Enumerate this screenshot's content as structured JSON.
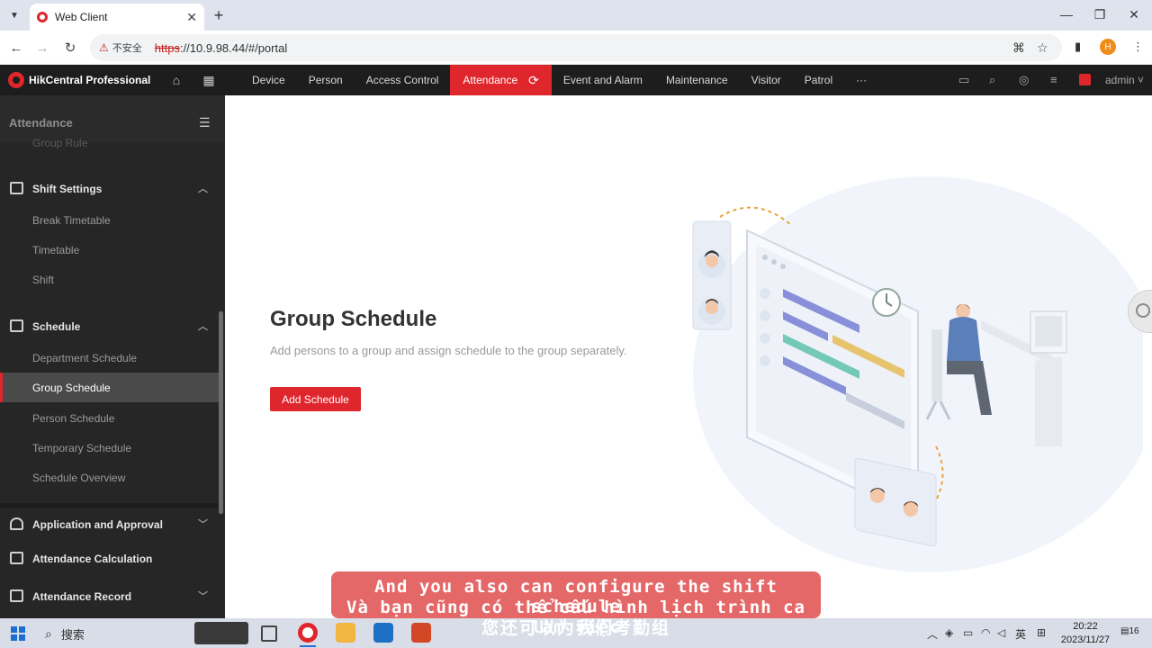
{
  "browser": {
    "tab_title": "Web Client",
    "url_scheme": "https",
    "url_rest": "://10.9.98.44/#/portal",
    "insecure_label": "不安全",
    "profile_initial": "H"
  },
  "app": {
    "name": "HikCentral Professional",
    "nav": [
      "Device",
      "Person",
      "Access Control",
      "Attendance",
      "Event and Alarm",
      "Maintenance",
      "Visitor",
      "Patrol",
      "···"
    ],
    "active_nav": "Attendance",
    "user": "admin"
  },
  "sidebar": {
    "title": "Attendance",
    "partial_item": "Group Rule",
    "shift_settings": {
      "label": "Shift Settings",
      "items": [
        "Break Timetable",
        "Timetable",
        "Shift"
      ]
    },
    "schedule": {
      "label": "Schedule",
      "items": [
        "Department Schedule",
        "Group Schedule",
        "Person Schedule",
        "Temporary Schedule",
        "Schedule Overview"
      ]
    },
    "groups": [
      "Application and Approval",
      "Attendance Calculation",
      "Attendance Record"
    ]
  },
  "main": {
    "title": "Group Schedule",
    "description": "Add persons to a group and assign schedule to the group separately.",
    "add_button": "Add Schedule"
  },
  "subtitle": {
    "en": "And you also can configure the shift schedule",
    "vi": "Và bạn cũng có thể cấu hình lịch trình ca làm việc",
    "zh": "您还可以为我们考勤组"
  },
  "taskbar": {
    "search_label": "搜索",
    "ime": "英",
    "time": "20:22",
    "date": "2023/11/27",
    "notifications": "16"
  },
  "colors": {
    "accent": "#e0262d",
    "header_bg": "#1d1d1d",
    "sidebar_bg": "#262626"
  }
}
